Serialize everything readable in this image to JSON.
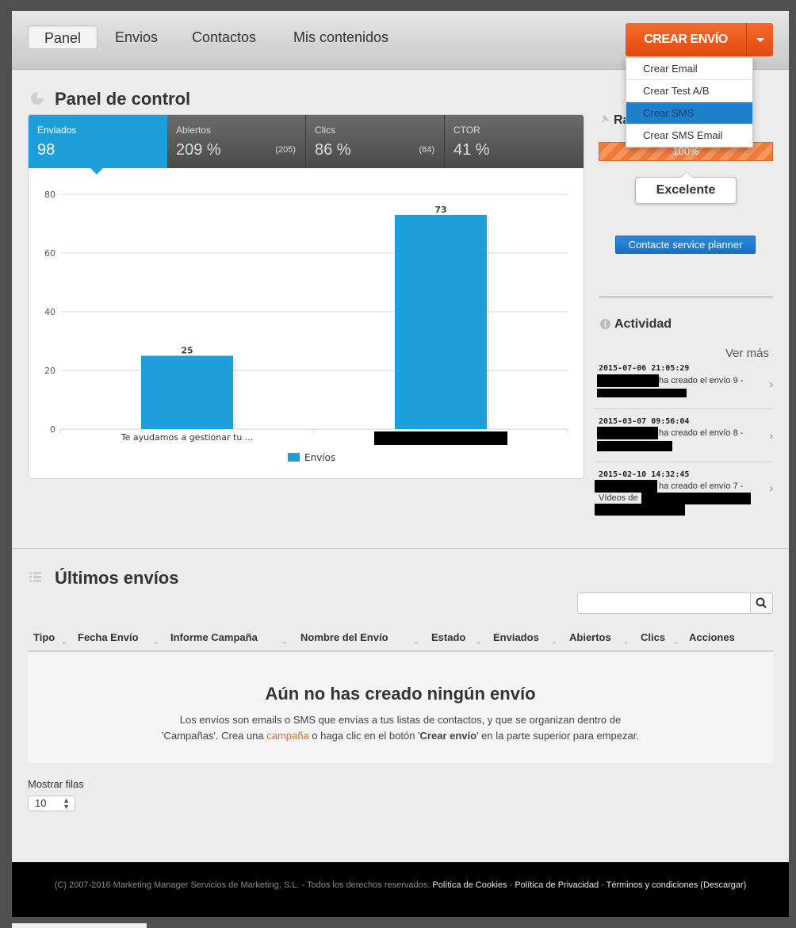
{
  "nav": {
    "items": [
      {
        "label": "Panel",
        "active": true
      },
      {
        "label": "Envios"
      },
      {
        "label": "Contactos"
      },
      {
        "label": "Mis contenidos"
      }
    ],
    "create_button": "CREAR ENVÍO",
    "create_menu": [
      {
        "label": "Crear Email"
      },
      {
        "label": "Crear Test A/B"
      },
      {
        "label": "Crear SMS",
        "selected": true
      },
      {
        "label": "Crear SMS Email"
      }
    ]
  },
  "dashboard": {
    "title": "Panel de control",
    "tabs": [
      {
        "label": "Enviados",
        "value": "98",
        "count": ""
      },
      {
        "label": "Abiertos",
        "value": "209 %",
        "count": "(205)"
      },
      {
        "label": "Clics",
        "value": "86 %",
        "count": "(84)"
      },
      {
        "label": "CTOR",
        "value": "41 %",
        "count": ""
      }
    ]
  },
  "chart_data": {
    "type": "bar",
    "categories": [
      "Te ayudamos a gestionar tu ...",
      ""
    ],
    "series": [
      {
        "name": "Envíos",
        "values": [
          25,
          73
        ],
        "color": "#1f9fd9"
      }
    ],
    "ylim": [
      0,
      80
    ],
    "yticks": [
      "0",
      "20",
      "40",
      "60",
      "80"
    ],
    "data_labels": [
      "25",
      "73"
    ],
    "grid": true,
    "legend": "bottom-center"
  },
  "rating": {
    "title_partial": "Ra",
    "bar_text": "100%",
    "level": 1.0,
    "badge": "Excelente",
    "contact_button": "Contacte service planner"
  },
  "activity": {
    "title": "Actividad",
    "see_more": "Ver más",
    "items": [
      {
        "date": "2015-07-06 21:05:29",
        "text": "ha creado el envío 9 -"
      },
      {
        "date": "2015-03-07 09:56:04",
        "text": "ha creado el envío 8 -"
      },
      {
        "date": "2015-02-10 14:32:45",
        "text": "ha creado el envío 7 -",
        "extra": "Vídeos de"
      }
    ]
  },
  "sends": {
    "title": "Últimos envíos",
    "columns": [
      "Tipo",
      "Fecha Envío",
      "Informe Campaña",
      "Nombre del Envío",
      "Estado",
      "Enviados",
      "Abiertos",
      "Clics",
      "Acciones"
    ],
    "empty_title": "Aún no has creado ningún envío",
    "empty_line1": "Los envíos son emails o SMS que envías a tus listas de contactos, y que se organizan dentro de",
    "empty_line2_a": "'Campañas'. Crea una ",
    "empty_link": "campaña",
    "empty_line2_b": " o haga clic en el botón '",
    "empty_bold": "Crear envío",
    "empty_line2_c": "' en la parte superior para empezar.",
    "rows_label": "Mostrar filas",
    "rows_value": "10"
  },
  "footer": {
    "copyright": "(C) 2007-2016 Marketing Manager Servicios de Marketing, S.L. - Todos los derechos reservados.",
    "links": [
      "Política de Cookies",
      "Política de Privacidad",
      "Términos y condiciones (Descargar)"
    ]
  },
  "colors": {
    "accent": "#1f9fd9",
    "brand": "#e44b0d",
    "link": "#e8662a"
  }
}
